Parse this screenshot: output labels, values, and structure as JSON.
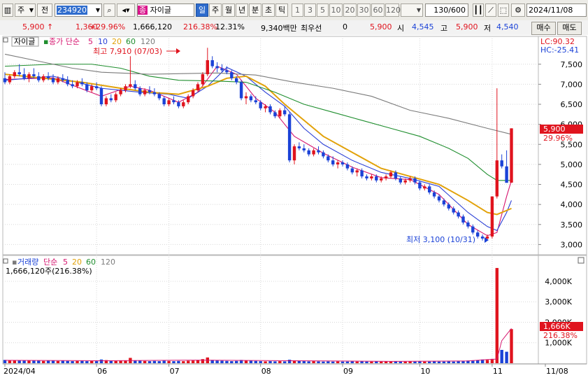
{
  "toolbar": {
    "market_label": "주",
    "type_label": "전",
    "code": "234920",
    "stock_name_badge": "종",
    "stock_name": "자이글",
    "period_tabs": [
      "일",
      "주",
      "월",
      "년",
      "분",
      "초",
      "틱"
    ],
    "minute_options": [
      "1",
      "3",
      "5",
      "10",
      "20",
      "30",
      "60",
      "120"
    ],
    "count": "130/600",
    "date": "2024/11/08"
  },
  "quote": {
    "price": "5,900",
    "arrow": "↑",
    "change": "1,360",
    "change_pct": "+29.96%",
    "volume": "1,666,120",
    "volume_ratio": "216.38%",
    "turnover": "12.31%",
    "amount": "9,340백만",
    "best_bid_label": "최우선",
    "best_bid_value": "0",
    "current_price2": "5,900",
    "open_label": "시",
    "open_value": "4,545",
    "high_label": "고",
    "high_value": "5,900",
    "low_label": "저",
    "low_value": "4,540",
    "buy_button": "매수",
    "sell_button": "매도"
  },
  "price_panel": {
    "name_tag": "자이글",
    "ma_label": "종가 단순",
    "ma_periods": [
      "5",
      "10",
      "20",
      "60",
      "120"
    ],
    "ma_colors": [
      "#d6156f",
      "#2a3fd6",
      "#e2a20a",
      "#1f8e2e",
      "#7b7b7b"
    ],
    "lc_label": "LC:90.32",
    "hc_label": "HC:-25.41",
    "high_annotation": "최고 7,910 (07/03)",
    "low_annotation": "최저 3,100 (10/31)",
    "price_box": "5,900",
    "pct_box": "29.96%"
  },
  "volume_panel": {
    "title": "거래량",
    "ma_label": "단순",
    "ma_periods": [
      "5",
      "20",
      "60",
      "120"
    ],
    "current": "1,666,120주(216.38%)",
    "volume_box": "1,666K",
    "volume_pct": "216.38%"
  },
  "x_axis": [
    "2024/04",
    "06",
    "07",
    "08",
    "09",
    "10",
    "11",
    "11/08"
  ],
  "chart_data": {
    "type": "candlestick",
    "price_axis": [
      "7,500",
      "7,000",
      "6,500",
      "6,000",
      "5,500",
      "5,000",
      "4,500",
      "4,000",
      "3,500",
      "3,000"
    ],
    "price_ticks": [
      7500,
      7000,
      6500,
      6000,
      5500,
      5000,
      4500,
      4000,
      3500,
      3000
    ],
    "volume_axis": [
      "4,000K",
      "3,000K",
      "2,000K",
      "1,000K"
    ],
    "volume_ticks": [
      4000,
      3000,
      2000,
      1000
    ],
    "ylim_price": [
      2850,
      7880
    ],
    "ylim_volume": [
      0,
      4750
    ],
    "candles": [
      [
        7150,
        7300,
        7000,
        7050
      ],
      [
        7050,
        7250,
        7000,
        7200
      ],
      [
        7200,
        7350,
        7150,
        7300
      ],
      [
        7300,
        7500,
        7200,
        7250
      ],
      [
        7250,
        7400,
        7100,
        7150
      ],
      [
        7150,
        7300,
        7050,
        7250
      ],
      [
        7250,
        7400,
        7150,
        7200
      ],
      [
        7200,
        7300,
        7050,
        7100
      ],
      [
        7100,
        7250,
        7050,
        7200
      ],
      [
        7200,
        7300,
        7100,
        7150
      ],
      [
        7150,
        7250,
        7000,
        7050
      ],
      [
        7050,
        7200,
        7000,
        7150
      ],
      [
        7150,
        7250,
        7050,
        7100
      ],
      [
        7100,
        7200,
        6950,
        7000
      ],
      [
        7000,
        7100,
        6900,
        6950
      ],
      [
        6950,
        7100,
        6900,
        7050
      ],
      [
        7050,
        7150,
        6950,
        7000
      ],
      [
        7000,
        7050,
        6800,
        6850
      ],
      [
        6850,
        7000,
        6800,
        6950
      ],
      [
        6950,
        7050,
        6850,
        6900
      ],
      [
        6900,
        6950,
        6450,
        6500
      ],
      [
        6500,
        6700,
        6450,
        6650
      ],
      [
        6650,
        6750,
        6550,
        6600
      ],
      [
        6600,
        6800,
        6550,
        6750
      ],
      [
        6750,
        6900,
        6700,
        6850
      ],
      [
        6850,
        7000,
        6800,
        6950
      ],
      [
        6950,
        7700,
        6900,
        7000
      ],
      [
        7000,
        7100,
        6850,
        6900
      ],
      [
        6900,
        6950,
        6700,
        6750
      ],
      [
        6750,
        6900,
        6700,
        6850
      ],
      [
        6850,
        6950,
        6750,
        6800
      ],
      [
        6800,
        6900,
        6700,
        6750
      ],
      [
        6750,
        6800,
        6600,
        6650
      ],
      [
        6650,
        6700,
        6450,
        6500
      ],
      [
        6500,
        6650,
        6450,
        6600
      ],
      [
        6600,
        6700,
        6500,
        6550
      ],
      [
        6550,
        6600,
        6400,
        6450
      ],
      [
        6450,
        6600,
        6400,
        6550
      ],
      [
        6550,
        6750,
        6500,
        6700
      ],
      [
        6700,
        6900,
        6650,
        6850
      ],
      [
        6850,
        7050,
        6800,
        7000
      ],
      [
        7000,
        7300,
        6950,
        7250
      ],
      [
        7250,
        7910,
        7200,
        7600
      ],
      [
        7600,
        7700,
        7400,
        7450
      ],
      [
        7450,
        7550,
        7300,
        7400
      ],
      [
        7400,
        7500,
        7300,
        7350
      ],
      [
        7350,
        7450,
        7250,
        7300
      ],
      [
        7300,
        7350,
        7100,
        7150
      ],
      [
        7150,
        7200,
        7000,
        7050
      ],
      [
        7050,
        7100,
        6600,
        6650
      ],
      [
        6650,
        6800,
        6500,
        6700
      ],
      [
        6700,
        6750,
        6550,
        6600
      ],
      [
        6600,
        6700,
        6500,
        6550
      ],
      [
        6550,
        6600,
        6350,
        6400
      ],
      [
        6400,
        6500,
        6300,
        6450
      ],
      [
        6450,
        6500,
        6250,
        6300
      ],
      [
        6300,
        6350,
        6150,
        6200
      ],
      [
        6200,
        6400,
        6150,
        6350
      ],
      [
        6350,
        6450,
        6200,
        6250
      ],
      [
        6250,
        6300,
        5050,
        5100
      ],
      [
        5100,
        5500,
        5000,
        5450
      ],
      [
        5450,
        5550,
        5350,
        5400
      ],
      [
        5400,
        5500,
        5300,
        5350
      ],
      [
        5350,
        5400,
        5200,
        5250
      ],
      [
        5250,
        5400,
        5200,
        5350
      ],
      [
        5350,
        5450,
        5250,
        5300
      ],
      [
        5300,
        5350,
        5150,
        5200
      ],
      [
        5200,
        5250,
        5050,
        5100
      ],
      [
        5100,
        5200,
        4950,
        5000
      ],
      [
        5000,
        5100,
        4900,
        5050
      ],
      [
        5050,
        5100,
        4950,
        5000
      ],
      [
        5000,
        5050,
        4850,
        4900
      ],
      [
        4900,
        4950,
        4750,
        4800
      ],
      [
        4800,
        4900,
        4700,
        4850
      ],
      [
        4850,
        4900,
        4650,
        4700
      ],
      [
        4700,
        4750,
        4600,
        4650
      ],
      [
        4650,
        4750,
        4600,
        4700
      ],
      [
        4700,
        4750,
        4550,
        4600
      ],
      [
        4600,
        4700,
        4550,
        4650
      ],
      [
        4650,
        4750,
        4600,
        4700
      ],
      [
        4700,
        4850,
        4650,
        4800
      ],
      [
        4800,
        4850,
        4600,
        4650
      ],
      [
        4650,
        4700,
        4500,
        4550
      ],
      [
        4550,
        4650,
        4500,
        4600
      ],
      [
        4600,
        4700,
        4550,
        4650
      ],
      [
        4650,
        4700,
        4500,
        4550
      ],
      [
        4550,
        4600,
        4350,
        4400
      ],
      [
        4400,
        4500,
        4350,
        4450
      ],
      [
        4450,
        4500,
        4250,
        4300
      ],
      [
        4300,
        4350,
        4150,
        4200
      ],
      [
        4200,
        4250,
        4050,
        4100
      ],
      [
        4100,
        4150,
        3950,
        4000
      ],
      [
        4000,
        4050,
        3850,
        3900
      ],
      [
        3900,
        3950,
        3750,
        3800
      ],
      [
        3800,
        3850,
        3650,
        3700
      ],
      [
        3700,
        3750,
        3500,
        3550
      ],
      [
        3550,
        3600,
        3400,
        3450
      ],
      [
        3450,
        3500,
        3250,
        3300
      ],
      [
        3300,
        3350,
        3150,
        3200
      ],
      [
        3200,
        3250,
        3100,
        3150
      ],
      [
        3150,
        3250,
        3100,
        3200
      ],
      [
        3200,
        4200,
        3150,
        4200
      ],
      [
        4200,
        6900,
        4150,
        5100
      ],
      [
        5100,
        5250,
        4900,
        4950
      ],
      [
        4950,
        5350,
        4600,
        4540
      ],
      [
        4545,
        5900,
        4540,
        5900
      ]
    ],
    "volumes": [
      160,
      140,
      150,
      130,
      120,
      140,
      130,
      120,
      110,
      130,
      120,
      110,
      120,
      110,
      100,
      110,
      120,
      100,
      110,
      100,
      180,
      150,
      120,
      110,
      120,
      130,
      260,
      140,
      120,
      110,
      100,
      110,
      100,
      120,
      110,
      100,
      110,
      100,
      120,
      130,
      150,
      200,
      280,
      160,
      130,
      120,
      110,
      100,
      110,
      160,
      130,
      120,
      110,
      100,
      90,
      100,
      90,
      100,
      90,
      170,
      140,
      110,
      100,
      90,
      100,
      90,
      80,
      90,
      80,
      90,
      80,
      80,
      90,
      80,
      90,
      80,
      80,
      90,
      80,
      90,
      100,
      90,
      80,
      80,
      90,
      80,
      90,
      80,
      80,
      90,
      80,
      80,
      90,
      80,
      100,
      120,
      130,
      140,
      150,
      180,
      160,
      210,
      4650,
      650,
      560,
      1666
    ],
    "ma": {
      "5": [
        [
          0,
          7120
        ],
        [
          10,
          7160
        ],
        [
          20,
          6700
        ],
        [
          26,
          6950
        ],
        [
          30,
          6850
        ],
        [
          36,
          6550
        ],
        [
          40,
          6800
        ],
        [
          44,
          7450
        ],
        [
          48,
          7250
        ],
        [
          52,
          6650
        ],
        [
          56,
          6300
        ],
        [
          60,
          5700
        ],
        [
          66,
          5280
        ],
        [
          72,
          4930
        ],
        [
          78,
          4670
        ],
        [
          84,
          4620
        ],
        [
          90,
          4250
        ],
        [
          96,
          3500
        ],
        [
          100,
          3220
        ],
        [
          102,
          3300
        ],
        [
          104,
          4200
        ],
        [
          105,
          4600
        ]
      ],
      "10": [
        [
          0,
          7100
        ],
        [
          10,
          7200
        ],
        [
          20,
          6900
        ],
        [
          28,
          6800
        ],
        [
          34,
          6750
        ],
        [
          38,
          6650
        ],
        [
          42,
          6950
        ],
        [
          46,
          7420
        ],
        [
          50,
          7200
        ],
        [
          54,
          6800
        ],
        [
          58,
          6450
        ],
        [
          62,
          5900
        ],
        [
          66,
          5500
        ],
        [
          72,
          5100
        ],
        [
          78,
          4800
        ],
        [
          84,
          4650
        ],
        [
          90,
          4450
        ],
        [
          96,
          3800
        ],
        [
          100,
          3450
        ],
        [
          102,
          3350
        ],
        [
          104,
          3800
        ],
        [
          105,
          4100
        ]
      ],
      "20": [
        [
          0,
          7250
        ],
        [
          8,
          7150
        ],
        [
          16,
          7050
        ],
        [
          24,
          6900
        ],
        [
          30,
          6800
        ],
        [
          36,
          6750
        ],
        [
          42,
          6950
        ],
        [
          46,
          7150
        ],
        [
          50,
          7200
        ],
        [
          54,
          6950
        ],
        [
          58,
          6500
        ],
        [
          62,
          6100
        ],
        [
          66,
          5700
        ],
        [
          72,
          5300
        ],
        [
          78,
          4900
        ],
        [
          84,
          4700
        ],
        [
          90,
          4500
        ],
        [
          96,
          4100
        ],
        [
          100,
          3800
        ],
        [
          102,
          3750
        ],
        [
          104,
          3850
        ],
        [
          105,
          3900
        ]
      ],
      "60": [
        [
          0,
          7450
        ],
        [
          10,
          7500
        ],
        [
          18,
          7500
        ],
        [
          24,
          7400
        ],
        [
          30,
          7200
        ],
        [
          36,
          7100
        ],
        [
          44,
          7080
        ],
        [
          50,
          7050
        ],
        [
          56,
          6800
        ],
        [
          62,
          6500
        ],
        [
          68,
          6300
        ],
        [
          74,
          6100
        ],
        [
          80,
          5900
        ],
        [
          86,
          5700
        ],
        [
          92,
          5400
        ],
        [
          96,
          5150
        ],
        [
          100,
          4750
        ],
        [
          102,
          4600
        ],
        [
          105,
          4600
        ]
      ],
      "120": [
        [
          0,
          7750
        ],
        [
          8,
          7550
        ],
        [
          14,
          7400
        ],
        [
          20,
          7300
        ],
        [
          30,
          7250
        ],
        [
          44,
          7280
        ],
        [
          52,
          7230
        ],
        [
          60,
          7050
        ],
        [
          68,
          6900
        ],
        [
          76,
          6700
        ],
        [
          84,
          6350
        ],
        [
          92,
          6150
        ],
        [
          100,
          5900
        ],
        [
          105,
          5750
        ]
      ]
    },
    "volume_ma5": [
      [
        0,
        140
      ],
      [
        20,
        120
      ],
      [
        40,
        150
      ],
      [
        60,
        120
      ],
      [
        80,
        90
      ],
      [
        96,
        110
      ],
      [
        100,
        180
      ],
      [
        102,
        200
      ],
      [
        103,
        1100
      ],
      [
        104,
        1400
      ],
      [
        105,
        1700
      ]
    ]
  }
}
